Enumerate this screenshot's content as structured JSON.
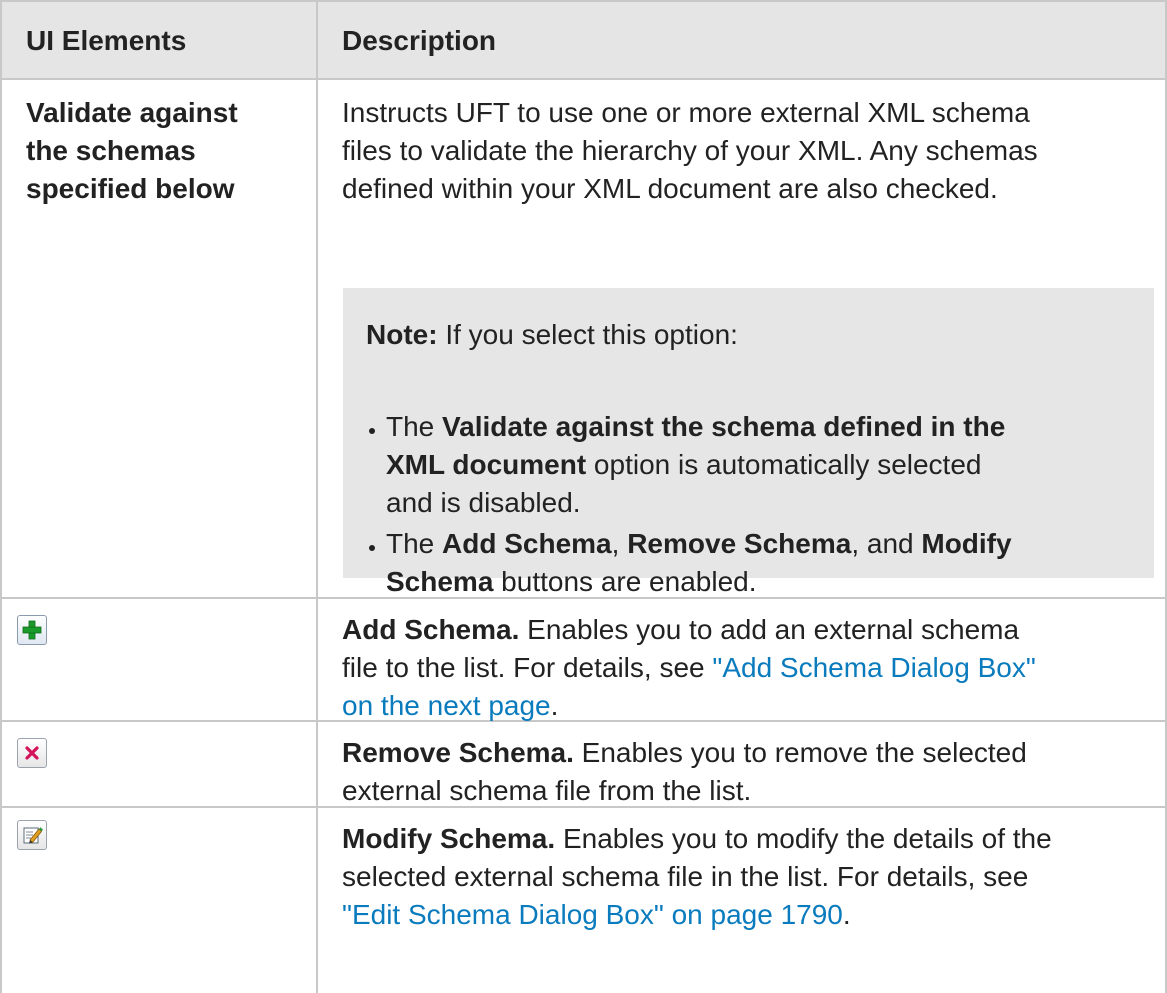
{
  "table": {
    "headers": {
      "col1": "UI Elements",
      "col2": "Description"
    },
    "row_validate": {
      "element": [
        "Validate against",
        "the schemas",
        "specified below"
      ],
      "desc": [
        "Instructs UFT to use one or more external XML schema",
        "files to validate the hierarchy of your XML. Any schemas",
        "defined within your XML document are also checked."
      ],
      "note": {
        "label": "Note:",
        "intro": " If you select this option:",
        "bullet1": {
          "p1": "The ",
          "b1": "Validate against the schema defined in the",
          "b2": "XML document",
          "p2": " option is automatically selected",
          "p3": "and is disabled."
        },
        "bullet2": {
          "p1": "The ",
          "b1": "Add Schema",
          "p2": ", ",
          "b2": "Remove Schema",
          "p3": ", and ",
          "b3": "Modify",
          "b4": "Schema",
          "p4": " buttons are enabled."
        }
      }
    },
    "row_add": {
      "icon": "add-green-plus-icon",
      "title": "Add Schema.",
      "text1": " Enables you to add an external schema",
      "text2": "file to the list. For details, see ",
      "link1": "\"Add Schema Dialog Box\"",
      "link2": "on the next page",
      "end": "."
    },
    "row_remove": {
      "icon": "remove-red-x-icon",
      "title": "Remove Schema.",
      "text1": " Enables you to remove the selected",
      "text2": "external schema file from the list."
    },
    "row_modify": {
      "icon": "edit-pencil-icon",
      "title": "Modify Schema.",
      "text1": " Enables you to modify the details of the",
      "text2": "selected external schema file in the list. For details, see",
      "link": "\"Edit Schema Dialog Box\" on page 1790",
      "end": "."
    }
  }
}
